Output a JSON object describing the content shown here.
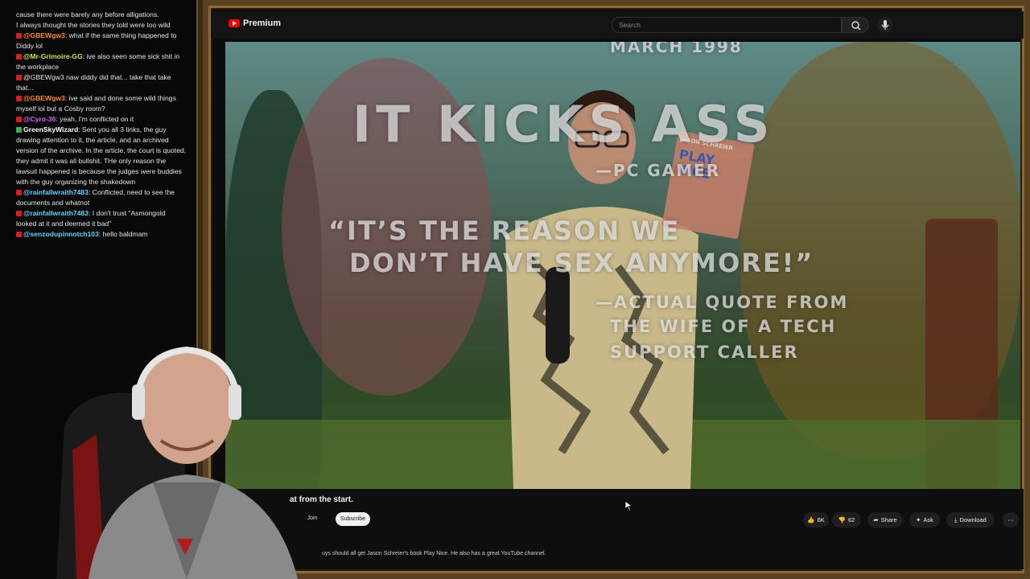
{
  "chat": {
    "messages": [
      {
        "user": "",
        "user_color": "#ffffff",
        "badge": "",
        "text": "cause there were barely any before alligations."
      },
      {
        "user": "",
        "user_color": "#ffffff",
        "badge": "",
        "text": "I always thought the stories they told were too wild"
      },
      {
        "user": "@GBEWgw3",
        "user_color": "#ff8a2b",
        "badge": "red",
        "text": ": what if the same thing happened to Diddy lol"
      },
      {
        "user": "@Mr-Grimoire-GG",
        "user_color": "#c6e64a",
        "badge": "red",
        "text": ": ive also seen some sick shit in the workplace"
      },
      {
        "user": "",
        "user_color": "#9b59ff",
        "badge": "red",
        "text": "@GBEWgw3 naw diddy did that... take that take that..."
      },
      {
        "user": "@GBEWgw3",
        "user_color": "#ff8a2b",
        "badge": "red",
        "text": ": ive said and done some wild things myself lol but a Cosby room?"
      },
      {
        "user": "@Cyro-36",
        "user_color": "#d15cff",
        "badge": "red",
        "text": ": yeah, I'm conflicted on it"
      },
      {
        "user": "GreenSkyWizard",
        "user_color": "#ffffff",
        "badge": "green",
        "text": ": Sent you all 3 links, the guy drawing attention to it, the article, and an archived version of the archive. In the article, the court is quoted, they admit it was all bullshit. THe only reason the lawsuit happened is because the judges were buddies with the guy organizing the shakedown"
      },
      {
        "user": "@rainfallwraith7483",
        "user_color": "#5fd3ff",
        "badge": "red",
        "text": ": Conflicted, need to see the documents and whatnot"
      },
      {
        "user": "@rainfallwraith7483",
        "user_color": "#5fd3ff",
        "badge": "red",
        "text": ": I don't trust \"Asmongold looked at it and deemed it bad\""
      },
      {
        "user": "@senzodupinnotch103",
        "user_color": "#5fd3ff",
        "badge": "red",
        "text": ": hello baldmam"
      }
    ]
  },
  "youtube": {
    "brand": "Premium",
    "search_placeholder": "Search",
    "video": {
      "overlay_top": "MARCH 1998",
      "headline": "IT KICKS ASS",
      "source": "—PC GAMER",
      "quote_line1": "“IT’S THE REASON WE",
      "quote_line2": "DON’T HAVE SEX ANYMORE!”",
      "attribution_line1": "—ACTUAL QUOTE FROM",
      "attribution_line2": "THE WIFE OF A TECH",
      "attribution_line3": "SUPPORT CALLER",
      "book_author": "JASON SCHREIER",
      "book_title": "PLAY NICE"
    },
    "title_fragment": "at from the start.",
    "join_label": "Join",
    "subscribe_label": "Subscribe",
    "likes": "6K",
    "dislikes": "62",
    "share_label": "Share",
    "ask_label": "Ask",
    "download_label": "Download",
    "description": "uys should all get Jason Schreier's book Play Nice. He also has a great YouTube channel."
  }
}
